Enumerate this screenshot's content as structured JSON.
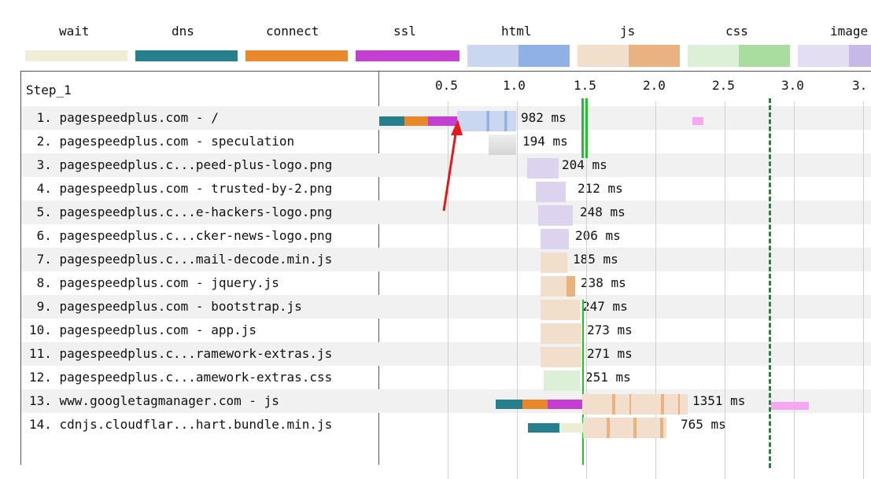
{
  "legend": [
    {
      "label": "wait",
      "color": "#eeeed7"
    },
    {
      "label": "dns",
      "color": "#277f8b"
    },
    {
      "label": "connect",
      "color": "#e9882a"
    },
    {
      "label": "ssl",
      "color": "#c43fd0"
    },
    {
      "label": "html",
      "color": "#b8cbec"
    },
    {
      "label": "js",
      "color": "#f2d5b9"
    },
    {
      "label": "css",
      "color": "#cae9c4"
    },
    {
      "label": "image",
      "color": "#dcd4ef"
    }
  ],
  "step_label": "Step_1",
  "axis_ticks": [
    "0.5",
    "1.0",
    "1.5",
    "2.0",
    "2.5",
    "3.0",
    "3."
  ],
  "requests": [
    {
      "name": " 1. pagespeedplus.com - /",
      "duration": "982 ms"
    },
    {
      "name": " 2. pagespeedplus.com - speculation",
      "duration": "194 ms"
    },
    {
      "name": " 3. pagespeedplus.c...peed-plus-logo.png",
      "duration": "204 ms"
    },
    {
      "name": " 4. pagespeedplus.com - trusted-by-2.png",
      "duration": "212 ms"
    },
    {
      "name": " 5. pagespeedplus.c...e-hackers-logo.png",
      "duration": "248 ms"
    },
    {
      "name": " 6. pagespeedplus.c...cker-news-logo.png",
      "duration": "206 ms"
    },
    {
      "name": " 7. pagespeedplus.c...mail-decode.min.js",
      "duration": "185 ms"
    },
    {
      "name": " 8. pagespeedplus.com - jquery.js",
      "duration": "238 ms"
    },
    {
      "name": " 9. pagespeedplus.com - bootstrap.js",
      "duration": "247 ms"
    },
    {
      "name": "10. pagespeedplus.com - app.js",
      "duration": "273 ms"
    },
    {
      "name": "11. pagespeedplus.c...ramework-extras.js",
      "duration": "271 ms"
    },
    {
      "name": "12. pagespeedplus.c...amework-extras.css",
      "duration": "251 ms"
    },
    {
      "name": "13. www.googletagmanager.com - js",
      "duration": "1351 ms"
    },
    {
      "name": "14. cdnjs.cloudflar...hart.bundle.min.js",
      "duration": "765 ms"
    }
  ]
}
